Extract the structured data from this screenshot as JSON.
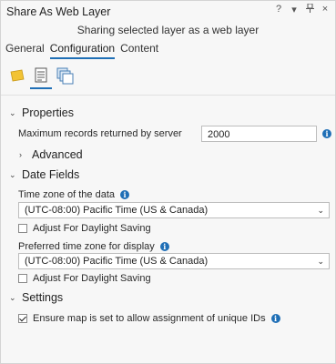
{
  "window": {
    "title": "Share As Web Layer",
    "subtitle": "Sharing selected layer as a web layer",
    "controls": [
      "?",
      "▾",
      "ᵤ",
      "×"
    ]
  },
  "tabs": [
    {
      "label": "General",
      "active": false
    },
    {
      "label": "Configuration",
      "active": true
    },
    {
      "label": "Content",
      "active": false
    }
  ],
  "toolbar": {
    "icons": [
      "layer-icon",
      "document-list-icon",
      "stacked-pages-icon"
    ],
    "selected": 1
  },
  "properties": {
    "header": "Properties",
    "max_records_label": "Maximum records returned by server",
    "max_records_value": "2000",
    "advanced_label": "Advanced"
  },
  "date_fields": {
    "header": "Date Fields",
    "timezone_label": "Time zone of the data",
    "timezone_value": "(UTC-08:00) Pacific Time (US & Canada)",
    "dst1_label": "Adjust For Daylight Saving",
    "preferred_label": "Preferred time zone for display",
    "preferred_value": "(UTC-08:00) Pacific Time (US & Canada)",
    "dst2_label": "Adjust For Daylight Saving"
  },
  "settings": {
    "header": "Settings",
    "unique_ids_label": "Ensure map is set to allow assignment of unique IDs",
    "unique_ids_checked": true
  },
  "colors": {
    "accent": "#1f6fb6",
    "background": "#f7f7f7"
  }
}
